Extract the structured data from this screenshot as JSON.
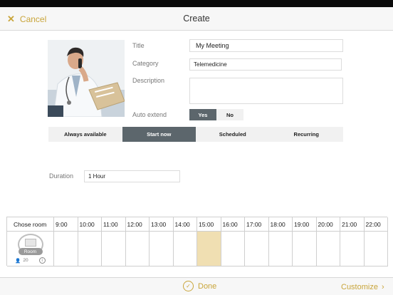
{
  "header": {
    "cancel_label": "Cancel",
    "title": "Create"
  },
  "form": {
    "title_label": "Title",
    "title_value": "My Meeting",
    "category_label": "Category",
    "category_value": "Telemedicine",
    "description_label": "Description",
    "description_value": "",
    "auto_extend_label": "Auto extend",
    "auto_extend_yes": "Yes",
    "auto_extend_no": "No",
    "auto_extend_selected": "Yes"
  },
  "availability_tabs": [
    {
      "label": "Always available",
      "selected": false
    },
    {
      "label": "Start now",
      "selected": true
    },
    {
      "label": "Scheduled",
      "selected": false
    },
    {
      "label": "Recurring",
      "selected": false
    }
  ],
  "duration": {
    "label": "Duration",
    "value": "1 Hour"
  },
  "room_grid": {
    "header_label": "Chose room",
    "times": [
      "9:00",
      "10:00",
      "11:00",
      "12:00",
      "13:00",
      "14:00",
      "15:00",
      "16:00",
      "17:00",
      "18:00",
      "19:00",
      "20:00",
      "21:00",
      "22:00"
    ],
    "highlighted_time": "15:00",
    "room": {
      "name": "Room",
      "capacity": "20"
    }
  },
  "footer": {
    "done_label": "Done",
    "customize_label": "Customize"
  },
  "colors": {
    "accent": "#c9a53a",
    "selected": "#5c666c",
    "highlight": "#f0dfb2"
  }
}
